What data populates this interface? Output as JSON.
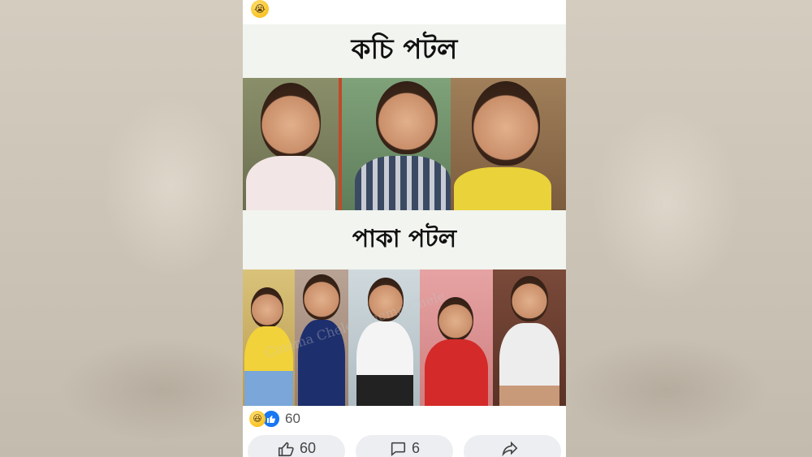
{
  "post": {
    "header_emoji": "😭",
    "meme_title_top": "কচি পটল",
    "meme_title_bottom": "পাকা পটল",
    "watermark": "Cinema Chele Cinema Chele"
  },
  "reactions": {
    "icons": [
      "haha-icon",
      "like-icon"
    ],
    "count": "60"
  },
  "actions": {
    "like_count": "60",
    "comment_count": "6",
    "share_icon": "share-icon"
  },
  "colors": {
    "like_blue": "#1877f2",
    "button_bg": "#eceef1",
    "title_band": "#f1f4ef"
  }
}
